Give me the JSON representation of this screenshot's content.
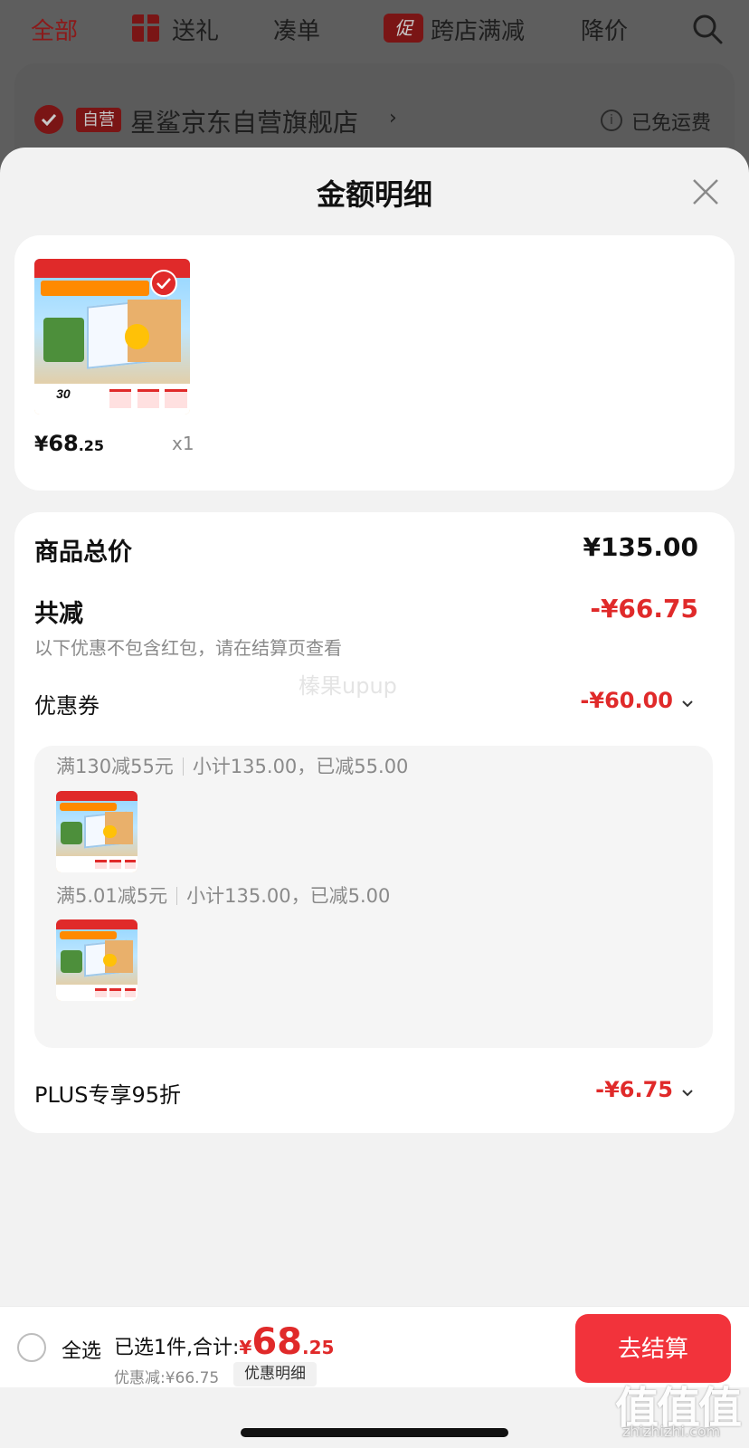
{
  "background": {
    "tabs": [
      "全部",
      "送礼",
      "凑单",
      "跨店满减",
      "降价"
    ],
    "promo_icon_text": "促",
    "shop": {
      "badge": "自营",
      "name": "星鲨京东自营旗舰店",
      "arrow": "›",
      "shipping": "已免运费",
      "info_glyph": "i"
    }
  },
  "sheet": {
    "title": "金额明细",
    "product": {
      "price_currency": "¥",
      "price_int": "68",
      "price_dec": ".25",
      "qty": "x1",
      "thumb_number": "30"
    },
    "detail": {
      "total_label": "商品总价",
      "total_value": "¥135.00",
      "reduce_label": "共减",
      "reduce_value": "-¥66.75",
      "note": "以下优惠不包含红包，请在结算页查看",
      "watermark": "榛果upup",
      "coupon_label": "优惠券",
      "coupon_value": "-¥60.00",
      "coupons": [
        {
          "rule": "满130减55元",
          "subtotal": "小计135.00，已减55.00"
        },
        {
          "rule": "满5.01减5元",
          "subtotal": "小计135.00，已减5.00"
        }
      ],
      "plus_label": "PLUS专享95折",
      "plus_value": "-¥6.75"
    }
  },
  "bottom_bar": {
    "select_all": "全选",
    "summary_prefix": "已选1件,合计:",
    "total_currency": "¥",
    "total_int": "68",
    "total_dec": ".25",
    "saved": "优惠减:¥66.75",
    "detail_chip": "优惠明细",
    "checkout": "去结算"
  },
  "site_mark": {
    "logo": "值值值",
    "url": "zhizhizhi.com"
  },
  "colors": {
    "accent_red": "#e02a2a",
    "checkout_red": "#f2333b",
    "overlay_gray": "#5e5e5e"
  }
}
